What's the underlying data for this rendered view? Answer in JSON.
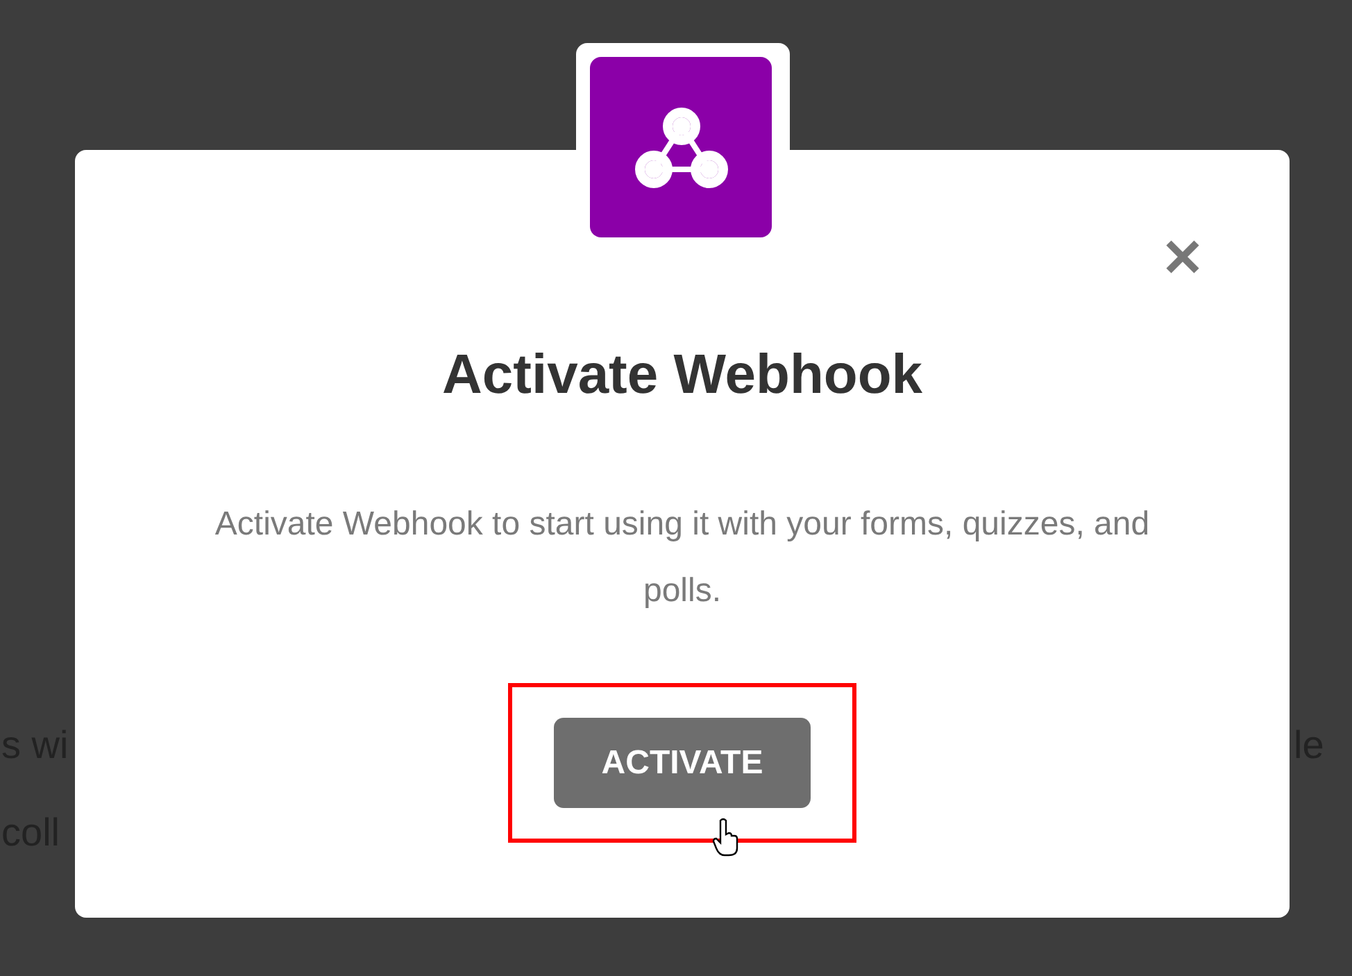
{
  "background": {
    "lines": [
      {
        "left": "s wi",
        "right": "le"
      },
      {
        "left": "coll"
      }
    ]
  },
  "modal": {
    "title": "Activate Webhook",
    "message": "Activate Webhook to start using it with your forms, quizzes, and polls.",
    "button": {
      "label": "ACTIVATE",
      "highlighted": true,
      "hovered": true
    }
  }
}
